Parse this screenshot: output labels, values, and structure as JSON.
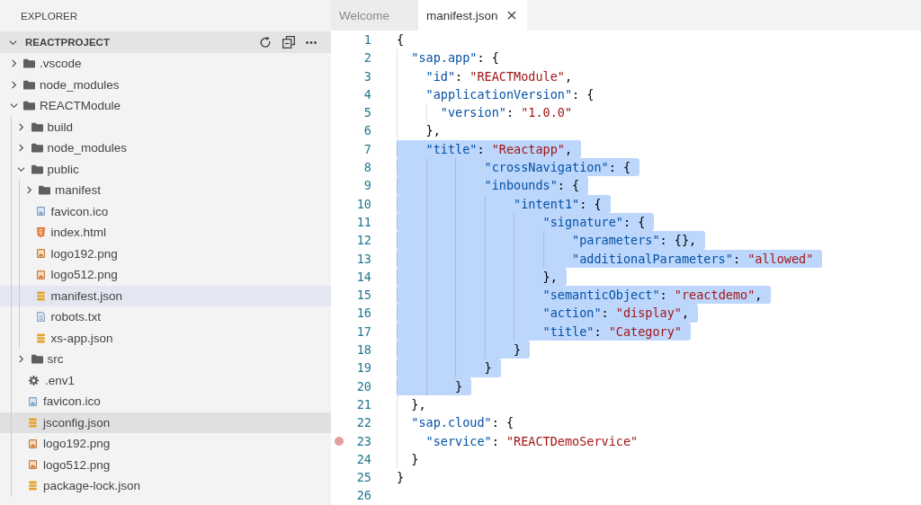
{
  "sidebar": {
    "title": "EXPLORER",
    "section": {
      "title": "REACTPROJECT",
      "expanded": true
    },
    "tree": [
      {
        "name": ".vscode",
        "kind": "folder",
        "expanded": false,
        "selected": false,
        "hovered": false
      },
      {
        "name": "node_modules",
        "kind": "folder",
        "expanded": false,
        "selected": false,
        "hovered": false
      },
      {
        "name": "REACTModule",
        "kind": "folder",
        "expanded": true,
        "selected": false,
        "hovered": false,
        "children": [
          {
            "name": "build",
            "kind": "folder",
            "expanded": false,
            "selected": false,
            "hovered": false
          },
          {
            "name": "node_modules",
            "kind": "folder",
            "expanded": false,
            "selected": false,
            "hovered": false
          },
          {
            "name": "public",
            "kind": "folder",
            "expanded": true,
            "selected": false,
            "hovered": false,
            "children": [
              {
                "name": "manifest",
                "kind": "folder",
                "expanded": false,
                "selected": false,
                "hovered": false
              },
              {
                "name": "favicon.ico",
                "kind": "ico",
                "selected": false,
                "hovered": false
              },
              {
                "name": "index.html",
                "kind": "html",
                "selected": false,
                "hovered": false
              },
              {
                "name": "logo192.png",
                "kind": "png",
                "selected": false,
                "hovered": false
              },
              {
                "name": "logo512.png",
                "kind": "png",
                "selected": false,
                "hovered": false
              },
              {
                "name": "manifest.json",
                "kind": "json",
                "selected": true,
                "hovered": false
              },
              {
                "name": "robots.txt",
                "kind": "txt",
                "selected": false,
                "hovered": false
              },
              {
                "name": "xs-app.json",
                "kind": "json",
                "selected": false,
                "hovered": false
              }
            ]
          },
          {
            "name": "src",
            "kind": "folder",
            "expanded": false,
            "selected": false,
            "hovered": false
          },
          {
            "name": ".env1",
            "kind": "env",
            "selected": false,
            "hovered": false
          },
          {
            "name": "favicon.ico",
            "kind": "ico",
            "selected": false,
            "hovered": false
          },
          {
            "name": "jsconfig.json",
            "kind": "json",
            "selected": false,
            "hovered": true
          },
          {
            "name": "logo192.png",
            "kind": "png",
            "selected": false,
            "hovered": false
          },
          {
            "name": "logo512.png",
            "kind": "png",
            "selected": false,
            "hovered": false
          },
          {
            "name": "package-lock.json",
            "kind": "json",
            "selected": false,
            "hovered": false
          }
        ]
      }
    ]
  },
  "editor": {
    "tabs": [
      {
        "label": "Welcome",
        "selected": false
      },
      {
        "label": "manifest.json",
        "selected": true
      }
    ],
    "lines": [
      {
        "number": "1",
        "text": "{",
        "selected": false,
        "breakpoint": false
      },
      {
        "number": "2",
        "text": "  \"sap.app\": {",
        "selected": false,
        "breakpoint": false
      },
      {
        "number": "3",
        "text": "    \"id\": \"REACTModule\",",
        "selected": false,
        "breakpoint": false
      },
      {
        "number": "4",
        "text": "    \"applicationVersion\": {",
        "selected": false,
        "breakpoint": false
      },
      {
        "number": "5",
        "text": "      \"version\": \"1.0.0\"",
        "selected": false,
        "breakpoint": false
      },
      {
        "number": "6",
        "text": "    },",
        "selected": false,
        "breakpoint": false
      },
      {
        "number": "7",
        "text": "    \"title\": \"Reactapp\",",
        "selected": true,
        "breakpoint": false
      },
      {
        "number": "8",
        "text": "            \"crossNavigation\": {",
        "selected": true,
        "breakpoint": false
      },
      {
        "number": "9",
        "text": "            \"inbounds\": {",
        "selected": true,
        "breakpoint": false
      },
      {
        "number": "10",
        "text": "                \"intent1\": {",
        "selected": true,
        "breakpoint": false
      },
      {
        "number": "11",
        "text": "                    \"signature\": {",
        "selected": true,
        "breakpoint": false
      },
      {
        "number": "12",
        "text": "                        \"parameters\": {},",
        "selected": true,
        "breakpoint": false
      },
      {
        "number": "13",
        "text": "                        \"additionalParameters\": \"allowed\"",
        "selected": true,
        "breakpoint": false
      },
      {
        "number": "14",
        "text": "                    },",
        "selected": true,
        "breakpoint": false
      },
      {
        "number": "15",
        "text": "                    \"semanticObject\": \"reactdemo\",",
        "selected": true,
        "breakpoint": false
      },
      {
        "number": "16",
        "text": "                    \"action\": \"display\",",
        "selected": true,
        "breakpoint": false
      },
      {
        "number": "17",
        "text": "                    \"title\": \"Category\"",
        "selected": true,
        "breakpoint": false
      },
      {
        "number": "18",
        "text": "                }",
        "selected": true,
        "breakpoint": false
      },
      {
        "number": "19",
        "text": "            }",
        "selected": true,
        "breakpoint": false
      },
      {
        "number": "20",
        "text": "        }",
        "selected": true,
        "breakpoint": false
      },
      {
        "number": "21",
        "text": "  },",
        "selected": false,
        "breakpoint": false
      },
      {
        "number": "22",
        "text": "  \"sap.cloud\": {",
        "selected": false,
        "breakpoint": false
      },
      {
        "number": "23",
        "text": "    \"service\": \"REACTDemoService\"",
        "selected": false,
        "breakpoint": true
      },
      {
        "number": "24",
        "text": "  }",
        "selected": false,
        "breakpoint": false
      },
      {
        "number": "25",
        "text": "}",
        "selected": false,
        "breakpoint": false
      },
      {
        "number": "26",
        "selected": false,
        "breakpoint": false
      }
    ]
  }
}
